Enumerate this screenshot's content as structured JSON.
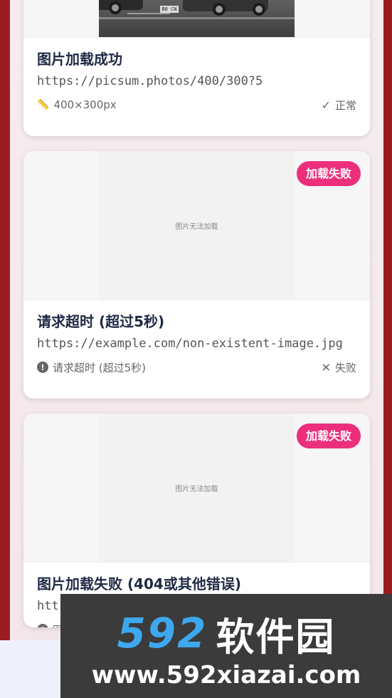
{
  "cards": [
    {
      "title": "图片加载成功",
      "url": "https://picsum.photos/400/300?5",
      "meta_left": "400×300px",
      "status": "正常"
    },
    {
      "badge": "加载失败",
      "placeholder": "图片无法加载",
      "title": "请求超时 (超过5秒)",
      "url": "https://example.com/non-existent-image.jpg",
      "meta_left": "请求超时 (超过5秒)",
      "status": "失败"
    },
    {
      "badge": "加载失败",
      "placeholder": "图片无法加载",
      "title": "图片加载失败 (404或其他错误)",
      "url": "htt",
      "meta_left": "图"
    }
  ],
  "watermark": {
    "number": "592",
    "name": "软件园",
    "url": "www.592xiazai.com"
  },
  "colors": {
    "badge": "#ec2f7b",
    "frame": "#9b1c1f",
    "title": "#1f2a44",
    "watermark_accent": "#3ea8ef"
  }
}
